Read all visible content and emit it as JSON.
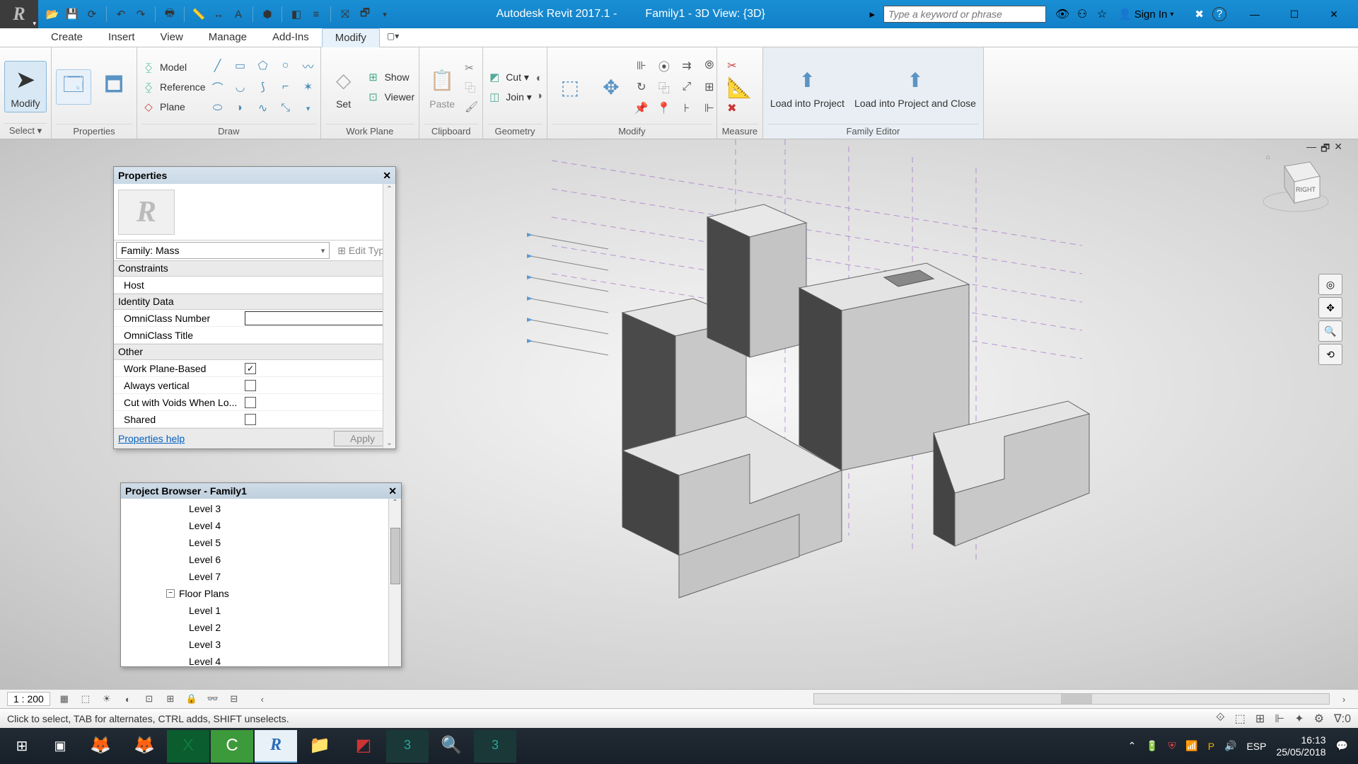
{
  "titlebar": {
    "app": "Autodesk Revit 2017.1 -",
    "doc": "Family1 - 3D View: {3D}",
    "search_placeholder": "Type a keyword or phrase",
    "signin": "Sign In"
  },
  "menubar": {
    "tabs": [
      "Create",
      "Insert",
      "View",
      "Manage",
      "Add-Ins",
      "Modify"
    ],
    "active": "Modify"
  },
  "ribbon": {
    "select": {
      "modify": "Modify",
      "label": "Select ▾"
    },
    "properties": {
      "label": "Properties"
    },
    "draw": {
      "model": "Model",
      "reference": "Reference",
      "plane": "Plane",
      "label": "Draw"
    },
    "workplane": {
      "set": "Set",
      "show": "Show",
      "viewer": "Viewer",
      "label": "Work Plane"
    },
    "clipboard": {
      "paste": "Paste",
      "label": "Clipboard"
    },
    "geometry": {
      "cut": "Cut ▾",
      "join": "Join ▾",
      "label": "Geometry"
    },
    "modify": {
      "label": "Modify"
    },
    "measure": {
      "label": "Measure"
    },
    "family": {
      "load_project": "Load into Project",
      "load_close": "Load into Project and Close",
      "label": "Family Editor"
    }
  },
  "properties": {
    "title": "Properties",
    "family_sel": "Family: Mass",
    "edit_type": "⊞ Edit Type",
    "categories": {
      "constraints": "Constraints",
      "identity": "Identity Data",
      "other": "Other"
    },
    "rows": {
      "host": "Host",
      "omni_num": "OmniClass Number",
      "omni_title": "OmniClass Title",
      "wpb": "Work Plane-Based",
      "wpb_checked": "✓",
      "always_v": "Always vertical",
      "cut_voids": "Cut with Voids When Lo...",
      "shared": "Shared"
    },
    "help": "Properties help",
    "apply": "Apply"
  },
  "browser": {
    "title": "Project Browser - Family1",
    "items": [
      "Level 3",
      "Level 4",
      "Level 5",
      "Level 6",
      "Level 7"
    ],
    "parent": "Floor Plans",
    "items2": [
      "Level 1",
      "Level 2",
      "Level 3",
      "Level 4"
    ]
  },
  "viewctrl": {
    "scale": "1 : 200"
  },
  "statusbar": {
    "msg": "Click to select, TAB for alternates, CTRL adds, SHIFT unselects.",
    "filter": "∇:0"
  },
  "taskbar": {
    "lang": "ESP",
    "time": "16:13",
    "date": "25/05/2018"
  },
  "viewcube": {
    "face": "RIGHT"
  }
}
